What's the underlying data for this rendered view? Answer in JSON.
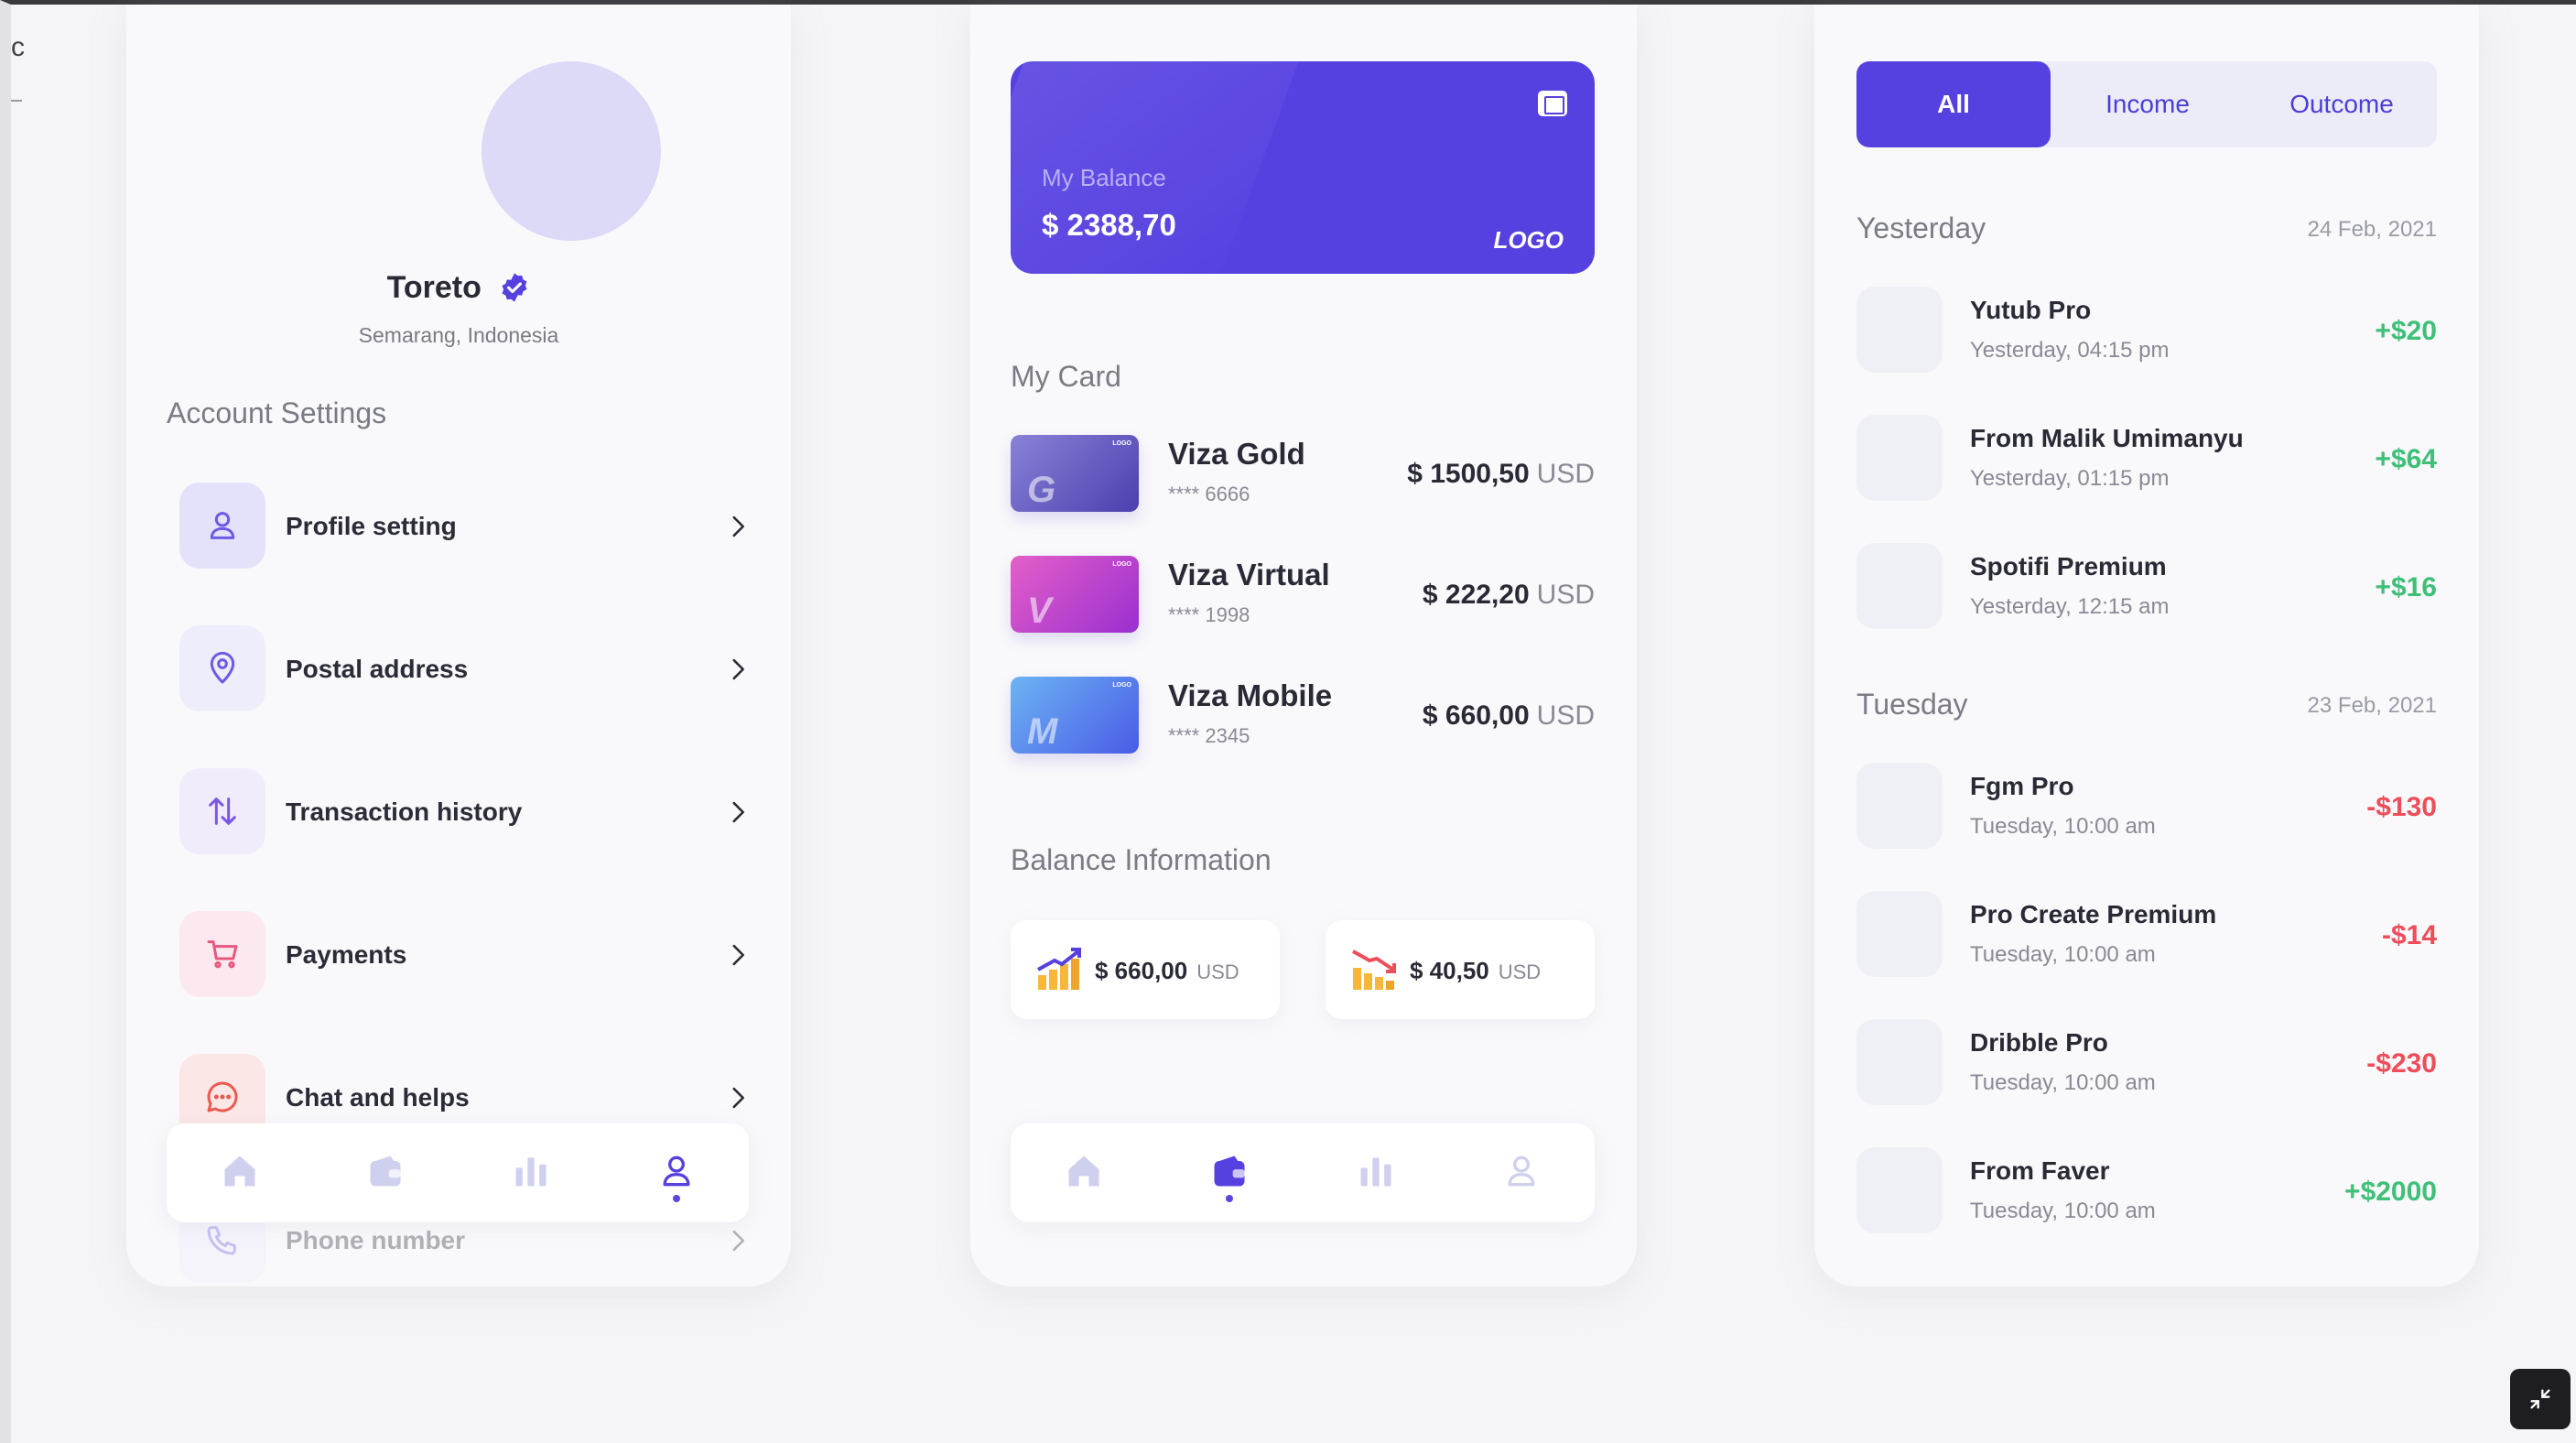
{
  "profile": {
    "name": "Toreto",
    "location": "Semarang, Indonesia",
    "account_settings_title": "Account Settings",
    "menu": [
      {
        "label": "Profile setting",
        "icon": "user-icon",
        "bg": "#e4e2fb",
        "fg": "#6b5be6"
      },
      {
        "label": "Postal address",
        "icon": "location-pin-icon",
        "bg": "#eeedfb",
        "fg": "#6b5be6"
      },
      {
        "label": "Transaction history",
        "icon": "transfer-arrows-icon",
        "bg": "#f1ecfb",
        "fg": "#7a58e6"
      },
      {
        "label": "Payments",
        "icon": "cart-icon",
        "bg": "#fbe9ef",
        "fg": "#e8587e"
      },
      {
        "label": "Chat and helps",
        "icon": "chat-icon",
        "bg": "#fbe7e6",
        "fg": "#ea5a4f"
      },
      {
        "label": "Phone number",
        "icon": "phone-icon",
        "bg": "#eeedfb",
        "fg": "#6b5be6"
      }
    ],
    "nav_active": 3
  },
  "wallet": {
    "balance_label": "My Balance",
    "balance_amount": "$ 2388,70",
    "logo_text": "LOGO",
    "my_card_title": "My Card",
    "cards": [
      {
        "name": "Viza Gold",
        "number": "**** 6666",
        "amount": "$ 1500,50",
        "currency": "USD",
        "gradient": "linear-gradient(135deg,#8a82d8,#4b3fae)",
        "glyph": "G"
      },
      {
        "name": "Viza Virtual",
        "number": "**** 1998",
        "amount": "$ 222,20",
        "currency": "USD",
        "gradient": "linear-gradient(135deg,#e45fc8,#9a2fd0)",
        "glyph": "V"
      },
      {
        "name": "Viza Mobile",
        "number": "**** 2345",
        "amount": "$ 660,00",
        "currency": "USD",
        "gradient": "linear-gradient(135deg,#6db4f4,#4a5be6)",
        "glyph": "M"
      }
    ],
    "balance_info_title": "Balance Information",
    "balance_info": [
      {
        "amount": "$ 660,00",
        "currency": "USD",
        "trend": "up"
      },
      {
        "amount": "$ 40,50",
        "currency": "USD",
        "trend": "down"
      }
    ],
    "card_logo_text": "LOGO",
    "nav_active": 1
  },
  "transactions": {
    "tabs": [
      "All",
      "Income",
      "Outcome"
    ],
    "active_tab": 0,
    "groups": [
      {
        "day": "Yesterday",
        "date": "24 Feb, 2021",
        "items": [
          {
            "name": "Yutub Pro",
            "time": "Yesterday, 04:15 pm",
            "amount": "+$20",
            "type": "pos"
          },
          {
            "name": "From Malik Umimanyu",
            "time": "Yesterday, 01:15 pm",
            "amount": "+$64",
            "type": "pos"
          },
          {
            "name": "Spotifi Premium",
            "time": "Yesterday, 12:15 am",
            "amount": "+$16",
            "type": "pos"
          }
        ]
      },
      {
        "day": "Tuesday",
        "date": "23 Feb, 2021",
        "items": [
          {
            "name": "Fgm Pro",
            "time": "Tuesday, 10:00 am",
            "amount": "-$130",
            "type": "neg"
          },
          {
            "name": "Pro Create Premium",
            "time": "Tuesday, 10:00 am",
            "amount": "-$14",
            "type": "neg"
          },
          {
            "name": "Dribble Pro",
            "time": "Tuesday, 10:00 am",
            "amount": "-$230",
            "type": "neg"
          },
          {
            "name": "From Faver",
            "time": "Tuesday, 10:00 am",
            "amount": "+$2000",
            "type": "pos"
          }
        ]
      }
    ]
  },
  "nav_icons": [
    "home-icon",
    "wallet-icon",
    "chart-icon",
    "user-icon"
  ],
  "accent": "#5540e0",
  "edge_text": "c"
}
